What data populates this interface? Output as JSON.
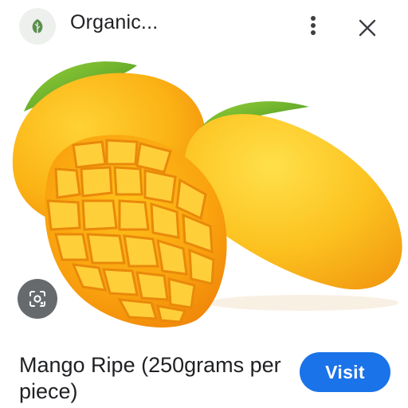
{
  "header": {
    "site_name": "Organic...",
    "site_icon": "leaf-icon",
    "more_icon": "more-vert-icon",
    "close_icon": "close-icon"
  },
  "image": {
    "subject": "mango-photo"
  },
  "lens": {
    "icon": "lens-search-icon"
  },
  "caption": {
    "title": "Mango Ripe (250grams per piece)"
  },
  "actions": {
    "visit_label": "Visit",
    "visit_icon": "open-external-icon"
  },
  "colors": {
    "accent": "#1a73e8",
    "text": "#202124"
  }
}
